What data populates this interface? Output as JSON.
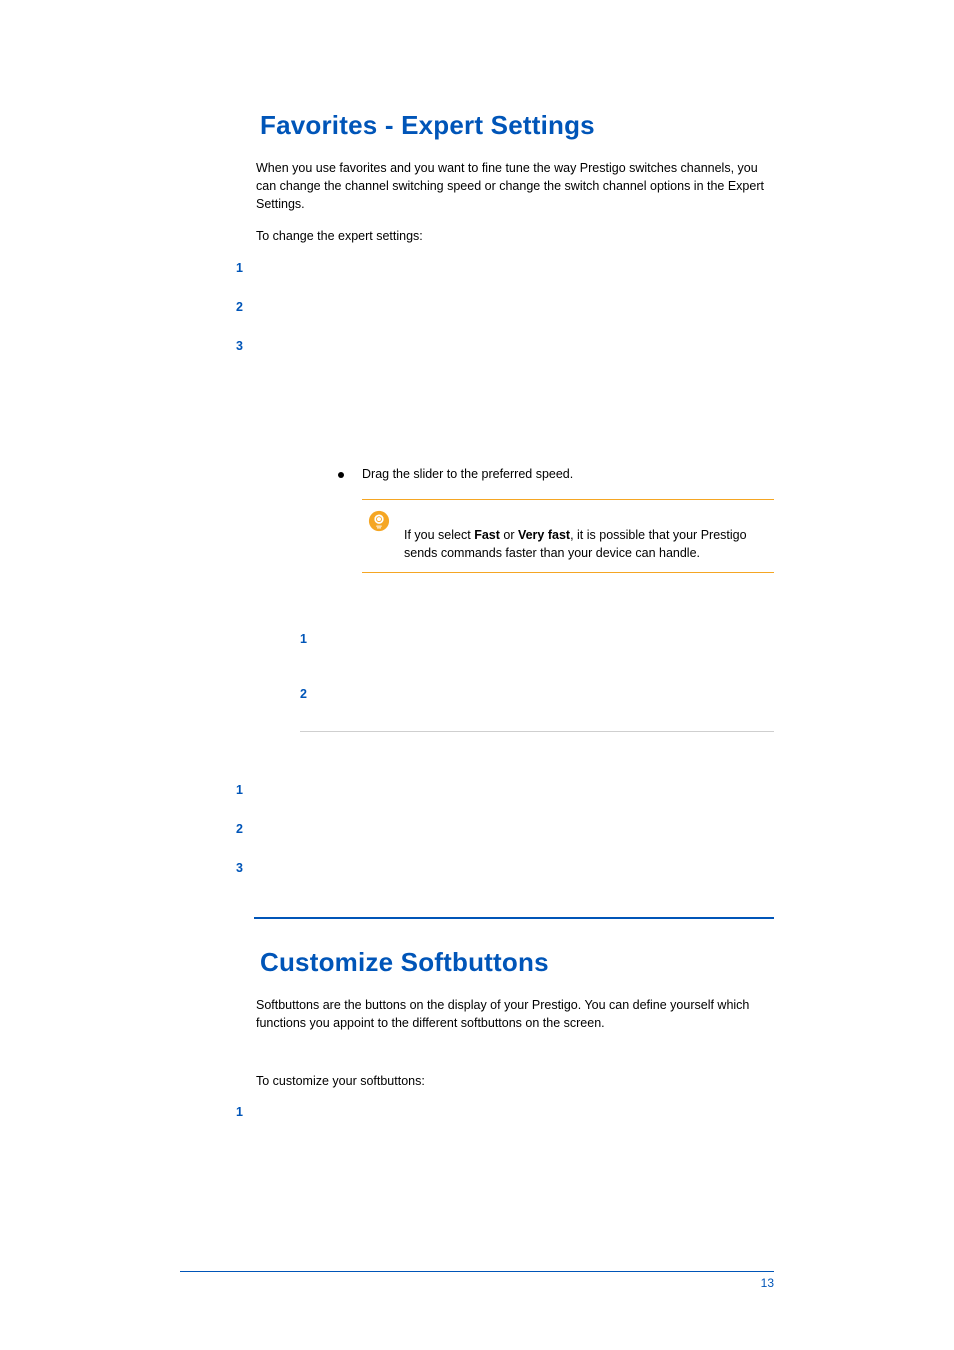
{
  "section1": {
    "title": "Favorites - Expert Settings",
    "intro": "When you use favorites and you want to fine tune the way Prestigo switches channels, you can change the channel switching speed or change the switch channel options in the Expert Settings.",
    "lead": "To change the expert settings:",
    "steps": {
      "n1": "1",
      "n2": "2",
      "n3": "3"
    },
    "bullet": "Drag the slider to the preferred speed.",
    "tip_pre": "If you select ",
    "tip_b1": "Fast",
    "tip_mid": " or ",
    "tip_b2": "Very fast",
    "tip_post": ", it is possible that your Prestigo sends commands faster than your device can handle.",
    "sub_steps": {
      "n1": "1",
      "n2": "2"
    },
    "steps_b": {
      "n1": "1",
      "n2": "2",
      "n3": "3"
    }
  },
  "section2": {
    "title": "Customize Softbuttons",
    "intro": "Softbuttons are the buttons on the display of your Prestigo. You can define yourself which functions you appoint to the different softbuttons on the screen.",
    "lead": "To customize your softbuttons:",
    "steps": {
      "n1": "1"
    }
  },
  "page_number": "13"
}
